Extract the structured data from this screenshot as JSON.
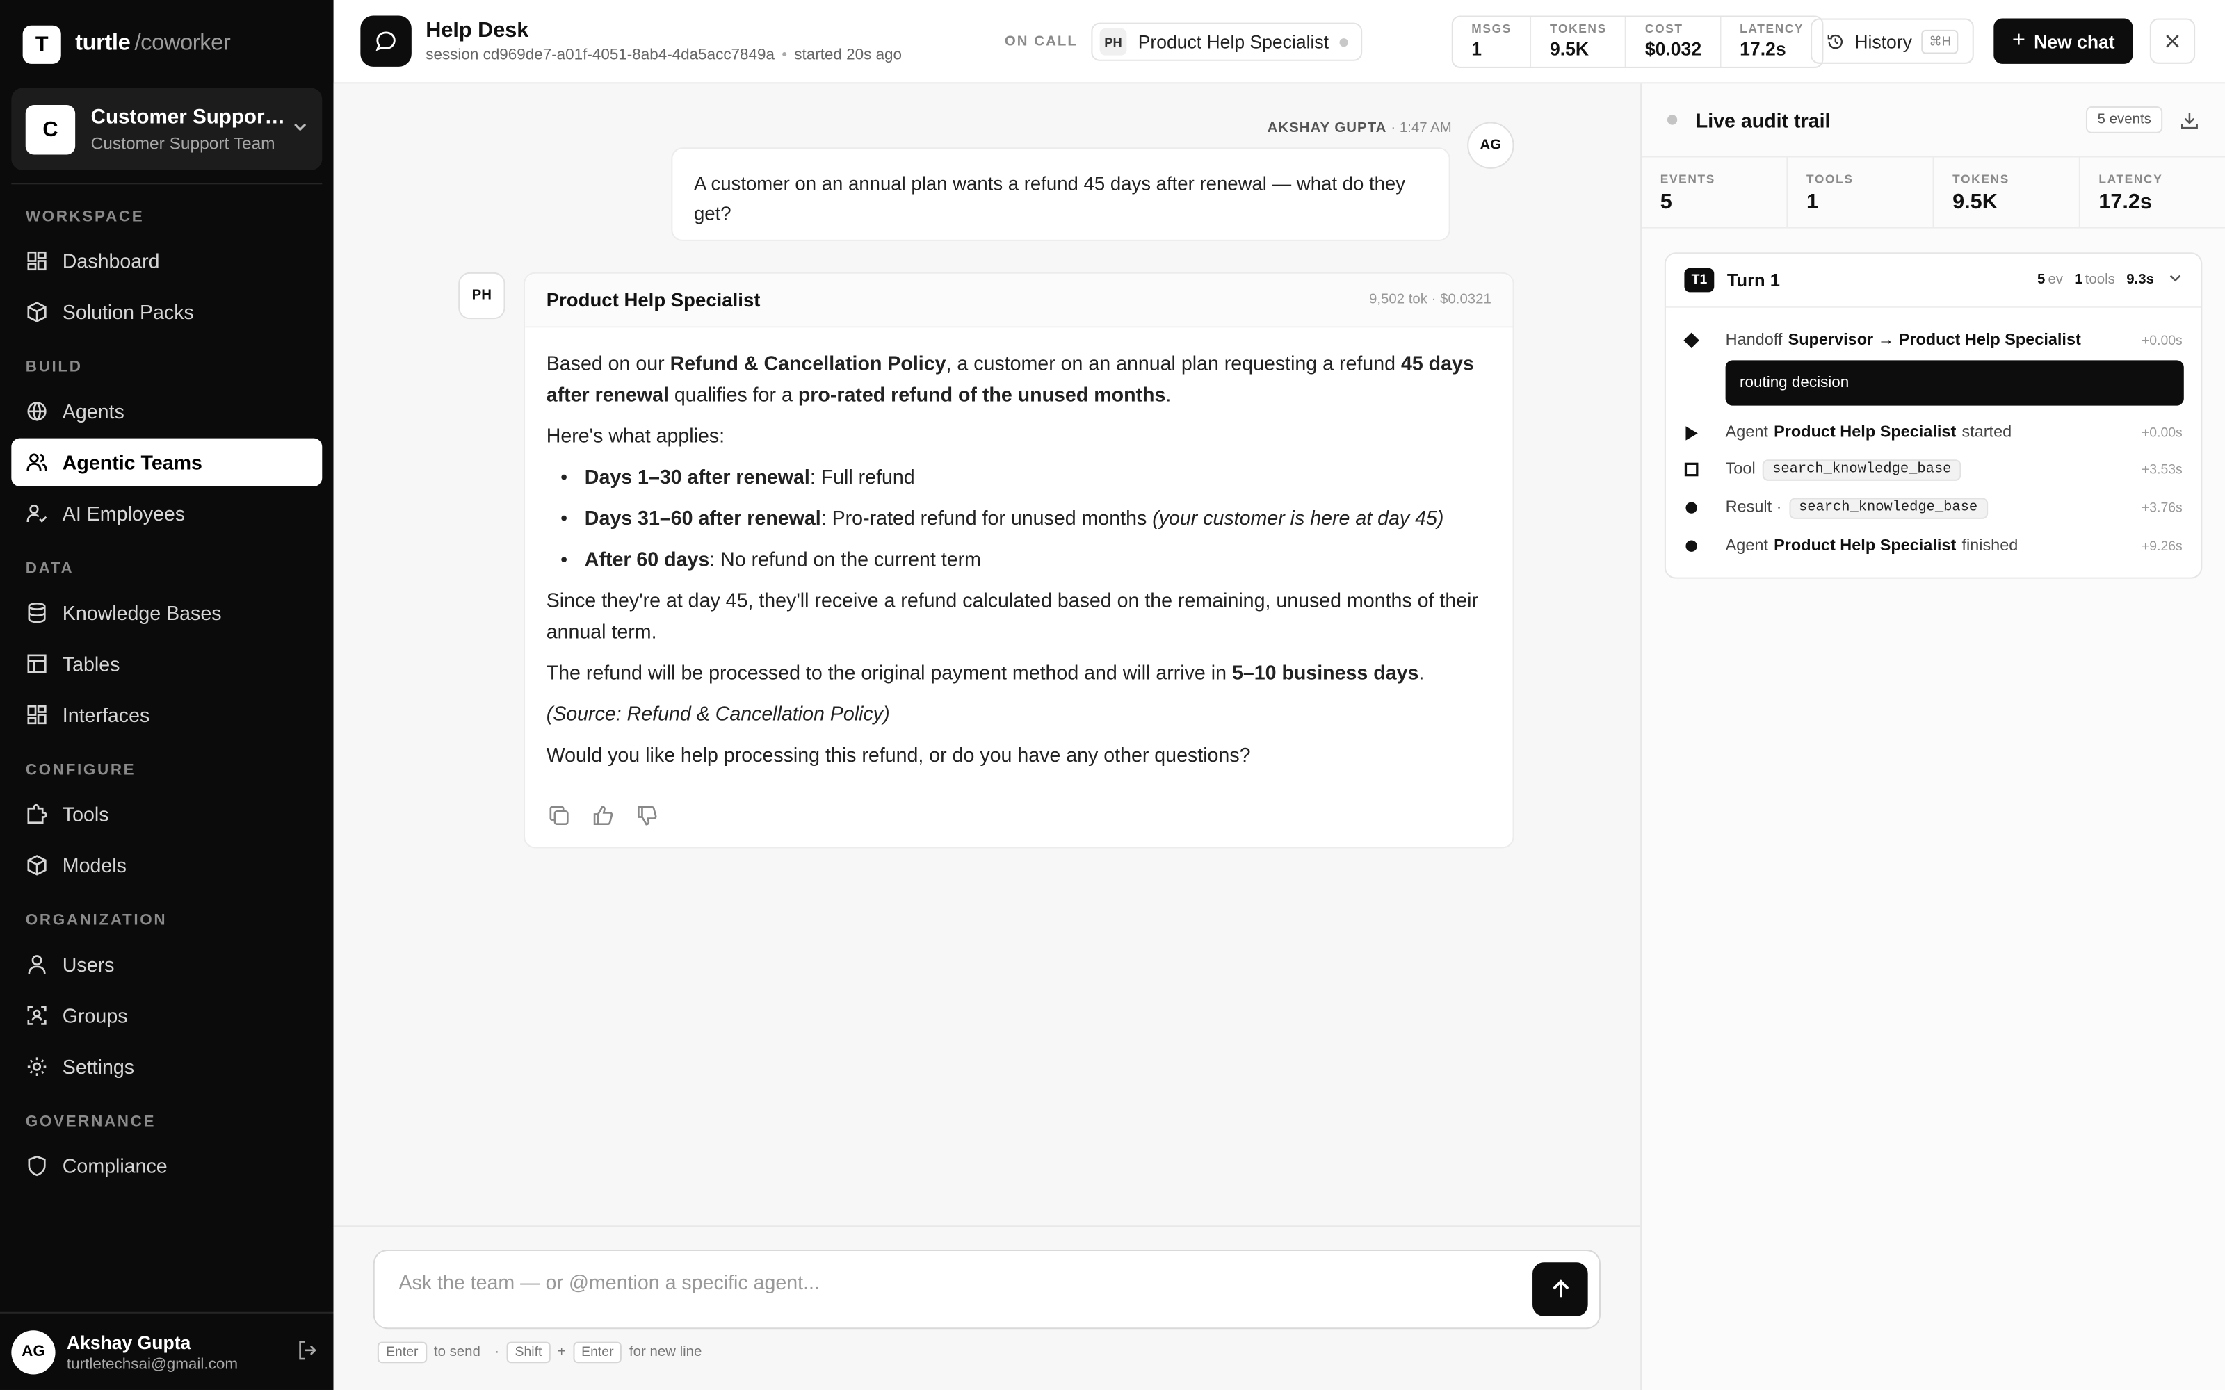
{
  "brand": {
    "logo_letter": "T",
    "name": "turtle",
    "sub": "/coworker"
  },
  "team": {
    "avatar": "C",
    "name": "Customer Support...",
    "sub": "Customer Support Team"
  },
  "nav": {
    "workspace": "WORKSPACE",
    "dashboard": "Dashboard",
    "solution_packs": "Solution Packs",
    "build": "BUILD",
    "agents": "Agents",
    "agentic_teams": "Agentic Teams",
    "ai_employees": "AI Employees",
    "data": "DATA",
    "knowledge_bases": "Knowledge Bases",
    "tables": "Tables",
    "interfaces": "Interfaces",
    "configure": "CONFIGURE",
    "tools": "Tools",
    "models": "Models",
    "organization": "ORGANIZATION",
    "users": "Users",
    "groups": "Groups",
    "settings": "Settings",
    "governance": "GOVERNANCE",
    "compliance": "Compliance"
  },
  "user": {
    "initials": "AG",
    "name": "Akshay Gupta",
    "email": "turtletechsai@gmail.com"
  },
  "header": {
    "title": "Help Desk",
    "session": "session cd969de7-a01f-4051-8ab4-4da5acc7849a",
    "started": "started 20s ago",
    "on_call": "ON CALL",
    "agent_initials": "PH",
    "agent_name": "Product Help Specialist",
    "metrics": [
      {
        "label": "MSGS",
        "value": "1"
      },
      {
        "label": "TOKENS",
        "value": "9.5K"
      },
      {
        "label": "COST",
        "value": "$0.032"
      },
      {
        "label": "LATENCY",
        "value": "17.2s"
      }
    ],
    "history_label": "History",
    "history_kbd": "⌘H",
    "new_chat_label": "New chat"
  },
  "chat": {
    "user_name": "AKSHAY GUPTA",
    "user_time": "· 1:47 AM",
    "user_initials": "AG",
    "user_message": "A customer on an annual plan wants a refund 45 days after renewal — what do they get?",
    "agent_initials": "PH",
    "agent_name": "Product Help Specialist",
    "agent_stats": "9,502 tok · $0.0321",
    "p1": {
      "a": "Based on our ",
      "b": "Refund & Cancellation Policy",
      "c": ", a customer on an annual plan requesting a refund ",
      "d": "45 days after renewal",
      "e": " qualifies for a ",
      "f": "pro-rated refund of the unused months",
      "g": "."
    },
    "p2": "Here's what applies:",
    "bullets": [
      {
        "bold": "Days 1–30 after renewal",
        "rest": ": Full refund",
        "italic": ""
      },
      {
        "bold": "Days 31–60 after renewal",
        "rest": ": Pro-rated refund for unused months ",
        "italic": "(your customer is here at day 45)"
      },
      {
        "bold": "After 60 days",
        "rest": ": No refund on the current term",
        "italic": ""
      }
    ],
    "p3": "Since they're at day 45, they'll receive a refund calculated based on the remaining, unused months of their annual term.",
    "p4": {
      "a": "The refund will be processed to the original payment method and will arrive in ",
      "b": "5–10 business days",
      "c": "."
    },
    "p5": "(Source: Refund & Cancellation Policy)",
    "p6": "Would you like help processing this refund, or do you have any other questions?"
  },
  "composer": {
    "placeholder": "Ask the team — or @mention a specific agent...",
    "value": "",
    "kbd_enter": "Enter",
    "to_send": "to send",
    "sep": "·",
    "kbd_shift": "Shift",
    "plus": "+",
    "kbd_enter2": "Enter",
    "new_line": "for new line"
  },
  "audit": {
    "title": "Live audit trail",
    "count": "5 events",
    "metrics": [
      {
        "label": "EVENTS",
        "value": "5"
      },
      {
        "label": "TOOLS",
        "value": "1"
      },
      {
        "label": "TOKENS",
        "value": "9.5K"
      },
      {
        "label": "LATENCY",
        "value": "17.2s"
      }
    ],
    "turn": {
      "badge": "T1",
      "name": "Turn 1",
      "ev_count": "5",
      "ev_unit": "ev",
      "tools_count": "1",
      "tools_unit": "tools",
      "duration": "9.3s"
    },
    "events": {
      "e1_type": "Handoff",
      "e1_detail": "Supervisor → Product Help Specialist",
      "e1_time": "+0.00s",
      "routing": "routing decision",
      "e2_type": "Agent",
      "e2_agent": "Product Help Specialist",
      "e2_suffix": "started",
      "e2_time": "+0.00s",
      "e3_type": "Tool",
      "e3_chip": "search_knowledge_base",
      "e3_time": "+3.53s",
      "e4_type": "Result ·",
      "e4_chip": "search_knowledge_base",
      "e4_time": "+3.76s",
      "e5_type": "Agent",
      "e5_agent": "Product Help Specialist",
      "e5_suffix": "finished",
      "e5_time": "+9.26s"
    }
  }
}
